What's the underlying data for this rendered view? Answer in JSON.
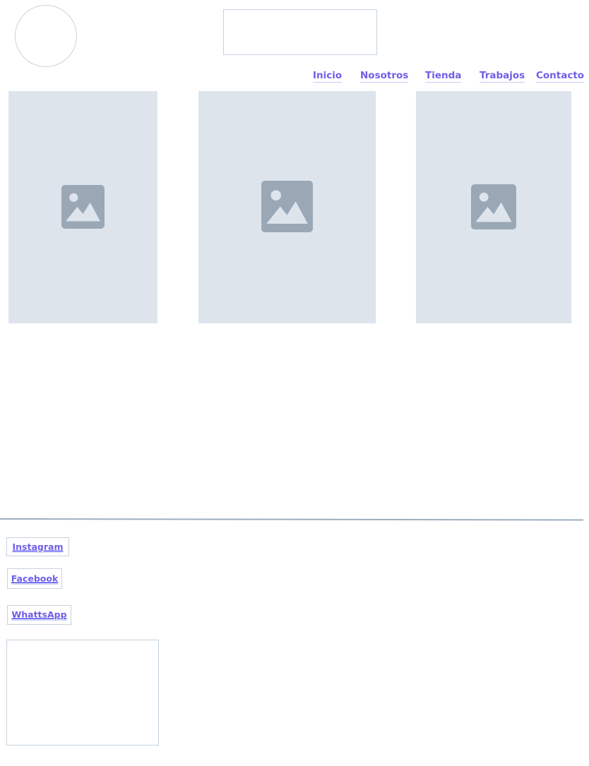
{
  "nav": {
    "items": [
      {
        "label": "Inicio"
      },
      {
        "label": "Nosotros"
      },
      {
        "label": "Tienda"
      },
      {
        "label": "Trabajos"
      },
      {
        "label": "Contacto"
      }
    ]
  },
  "gallery": {
    "cards": [
      {
        "icon": "image-placeholder-icon"
      },
      {
        "icon": "image-placeholder-icon"
      },
      {
        "icon": "image-placeholder-icon"
      }
    ]
  },
  "footer": {
    "social": [
      {
        "label": "Instagram"
      },
      {
        "label": "Facebook"
      },
      {
        "label": "WhattsApp"
      }
    ]
  },
  "colors": {
    "link": "#6f5ee8",
    "placeholder_bg": "#dee4ec",
    "placeholder_icon": "#9aa8b6",
    "border": "#c6d2de"
  }
}
